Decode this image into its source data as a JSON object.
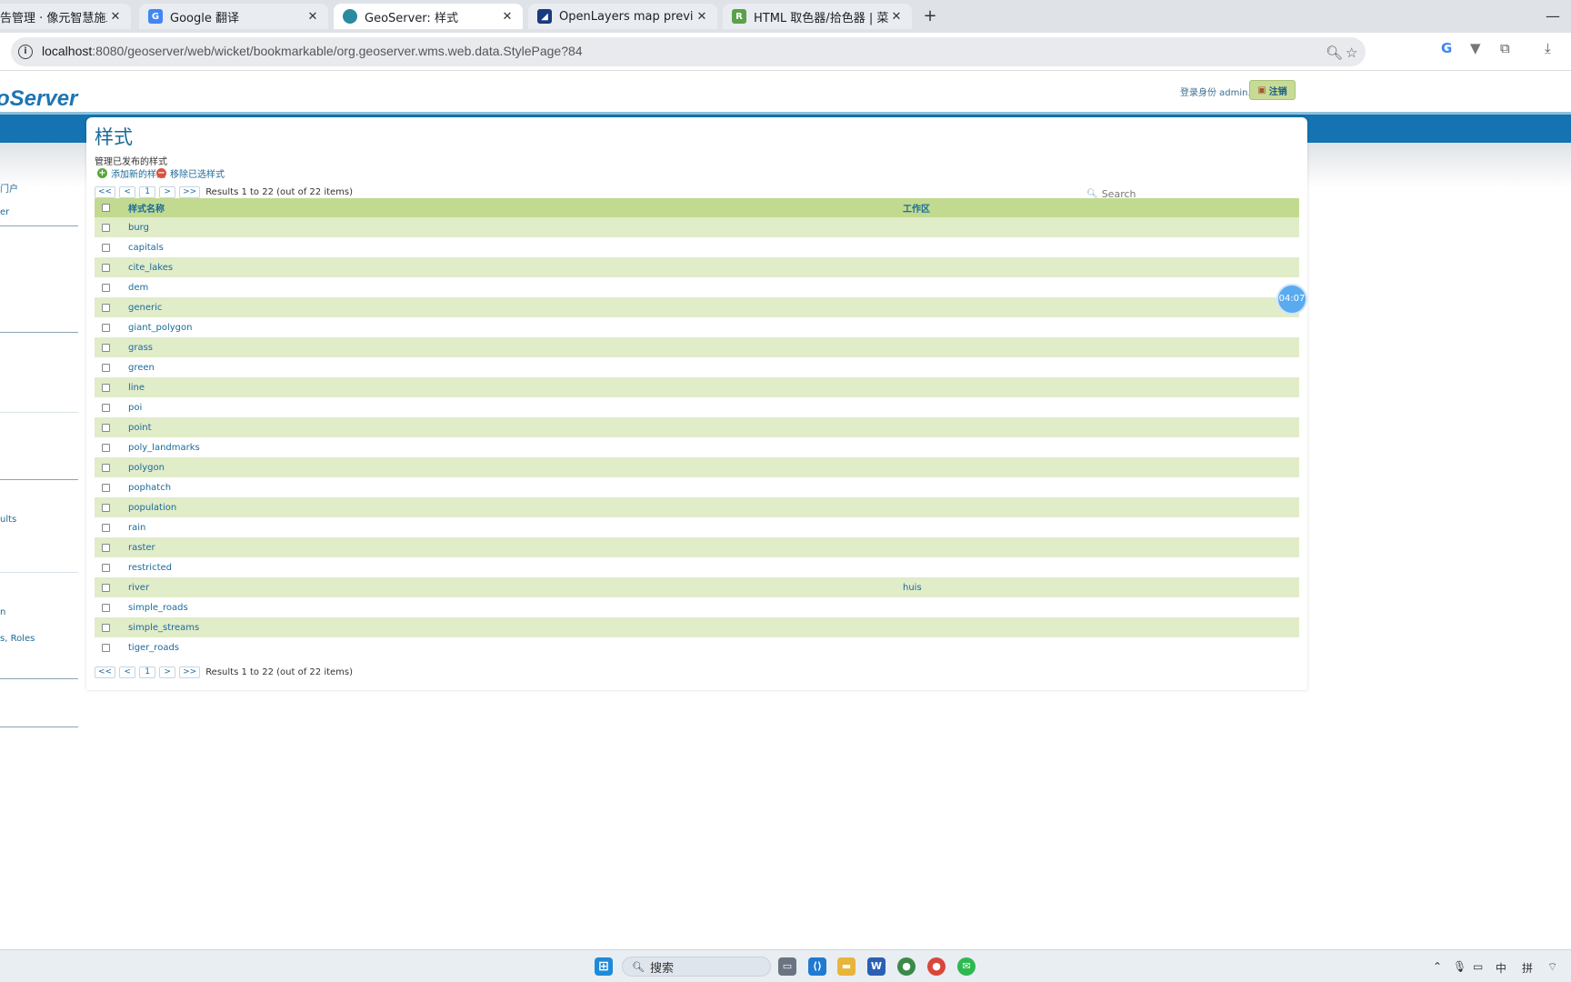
{
  "browser": {
    "tabs": [
      {
        "label": "告管理 · 像元智慧施工街道",
        "favicon_color": "#e5543b",
        "active": false
      },
      {
        "label": "Google 翻译",
        "favicon_color": "#4285f4",
        "active": false
      },
      {
        "label": "GeoServer: 样式",
        "favicon_color": "#2a8aa0",
        "active": true
      },
      {
        "label": "OpenLayers map preview",
        "favicon_color": "#1a3a80",
        "active": false
      },
      {
        "label": "HTML 取色器/拾色器 | 菜鸟教程",
        "favicon_color": "#5ba04a",
        "active": false
      }
    ],
    "close_glyph": "✕",
    "new_tab_glyph": "+",
    "url_host": "localhost",
    "url_rest": ":8080/geoserver/web/wicket/bookmarkable/org.geoserver.wms.web.data.StylePage?84"
  },
  "header": {
    "logo": "oServer",
    "login_info": "登录身份 admin.",
    "logout_label": "注销"
  },
  "sidebar": {
    "fragments": [
      "门户",
      "er",
      "ults",
      "n",
      "s, Roles"
    ]
  },
  "panel": {
    "title": "样式",
    "description": "管理已发布的样式",
    "add_label": "添加新的样式",
    "remove_label": "移除已选样式",
    "pager": {
      "first": "<<",
      "prev": "<",
      "page": "1",
      "next": ">",
      "last": ">>",
      "info": "Results 1 to 22 (out of 22 items)"
    },
    "search_placeholder": "Search"
  },
  "table": {
    "columns": [
      "样式名称",
      "工作区"
    ],
    "rows": [
      {
        "name": "burg",
        "workspace": ""
      },
      {
        "name": "capitals",
        "workspace": ""
      },
      {
        "name": "cite_lakes",
        "workspace": ""
      },
      {
        "name": "dem",
        "workspace": ""
      },
      {
        "name": "generic",
        "workspace": ""
      },
      {
        "name": "giant_polygon",
        "workspace": ""
      },
      {
        "name": "grass",
        "workspace": ""
      },
      {
        "name": "green",
        "workspace": ""
      },
      {
        "name": "line",
        "workspace": ""
      },
      {
        "name": "poi",
        "workspace": ""
      },
      {
        "name": "point",
        "workspace": ""
      },
      {
        "name": "poly_landmarks",
        "workspace": ""
      },
      {
        "name": "polygon",
        "workspace": ""
      },
      {
        "name": "pophatch",
        "workspace": ""
      },
      {
        "name": "population",
        "workspace": ""
      },
      {
        "name": "rain",
        "workspace": ""
      },
      {
        "name": "raster",
        "workspace": ""
      },
      {
        "name": "restricted",
        "workspace": ""
      },
      {
        "name": "river",
        "workspace": "huis"
      },
      {
        "name": "simple_roads",
        "workspace": ""
      },
      {
        "name": "simple_streams",
        "workspace": ""
      },
      {
        "name": "tiger_roads",
        "workspace": ""
      }
    ]
  },
  "timer": "04:07",
  "taskbar": {
    "search_label": "搜索",
    "tray": [
      "中",
      "拼"
    ]
  }
}
